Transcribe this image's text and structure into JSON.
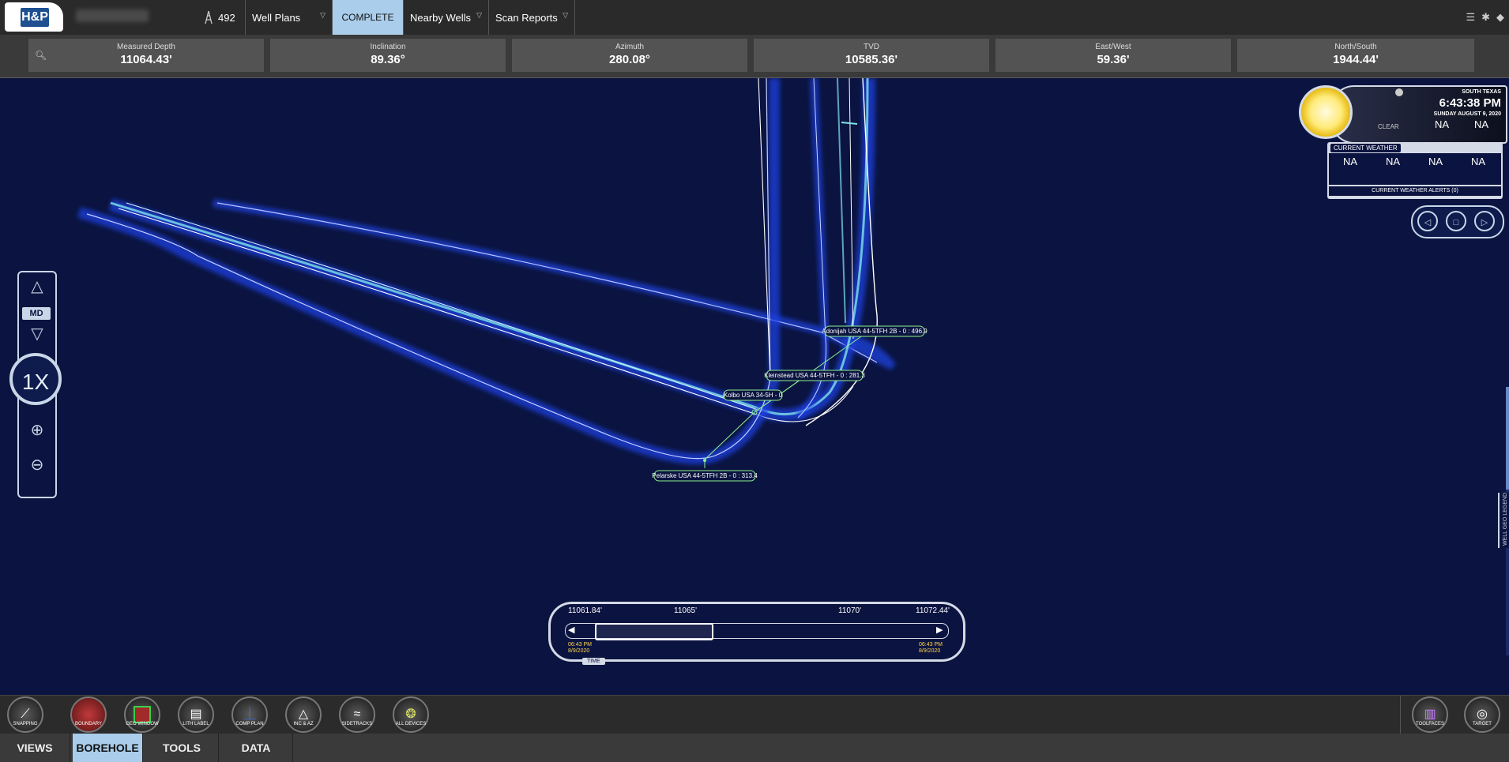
{
  "header": {
    "logo_text": "H&P",
    "rig_number": "492",
    "tabs": [
      {
        "label": "Well Plans"
      },
      {
        "label": "COMPLETE"
      },
      {
        "label": "Nearby Wells"
      },
      {
        "label": "Scan Reports"
      }
    ]
  },
  "metrics": [
    {
      "label": "Measured Depth",
      "value": "11064.43'"
    },
    {
      "label": "Inclination",
      "value": "89.36°"
    },
    {
      "label": "Azimuth",
      "value": "280.08°"
    },
    {
      "label": "TVD",
      "value": "10585.36'"
    },
    {
      "label": "East/West",
      "value": "59.36'"
    },
    {
      "label": "North/South",
      "value": "1944.44'"
    }
  ],
  "navigation": {
    "md_label": "MD",
    "zoom_level": "1X"
  },
  "wells": [
    {
      "label": "Adonijah USA 44-5TFH 2B - 0 : 496.9"
    },
    {
      "label": "Kleinstead USA 44-5TFH - 0 : 281.3"
    },
    {
      "label": "Kolbo USA 34-5H - 0"
    },
    {
      "label": "Pelarske USA 44-5TFH 2B - 0 : 313.4"
    }
  ],
  "weather": {
    "location": "SOUTH TEXAS",
    "time": "6:43:38 PM",
    "date": "SUNDAY AUGUST 9, 2020",
    "condition": "CLEAR",
    "top_values": [
      "NA",
      "NA"
    ],
    "panel_title": "CURRENT WEATHER",
    "panel_values": [
      "NA",
      "NA",
      "NA",
      "NA"
    ],
    "alerts": "CURRENT WEATHER ALERTS (0)"
  },
  "timeline": {
    "ticks": [
      "11061.84'",
      "11065'",
      "11070'",
      "11072.44'"
    ],
    "start_time": "06:43 PM",
    "start_date": "8/9/2020",
    "end_time": "06:43 PM",
    "end_date": "8/9/2020",
    "mode_label": "TIME"
  },
  "tools": [
    {
      "label": "SNAPPING",
      "icon": "snapping-icon"
    },
    {
      "label": "BOUNDARY",
      "icon": "boundary-icon"
    },
    {
      "label": "GEO WINDOW",
      "icon": "geo-window-icon"
    },
    {
      "label": "LITH LABEL",
      "icon": "lith-label-icon"
    },
    {
      "label": "COMP PLAN",
      "icon": "comp-plan-icon"
    },
    {
      "label": "INC & AZ",
      "icon": "inc-az-icon"
    },
    {
      "label": "SIDETRACKS",
      "icon": "sidetracks-icon"
    },
    {
      "label": "ALL DEVICES",
      "icon": "all-devices-icon"
    }
  ],
  "tools_right": [
    {
      "label": "TOOLFACES",
      "icon": "toolfaces-icon"
    },
    {
      "label": "TARGET",
      "icon": "target-icon"
    }
  ],
  "bottom_tabs": [
    {
      "label": "VIEWS"
    },
    {
      "label": "BOREHOLE"
    },
    {
      "label": "TOOLS"
    },
    {
      "label": "DATA"
    }
  ],
  "side_legend": "WELL GEO LEGEND"
}
